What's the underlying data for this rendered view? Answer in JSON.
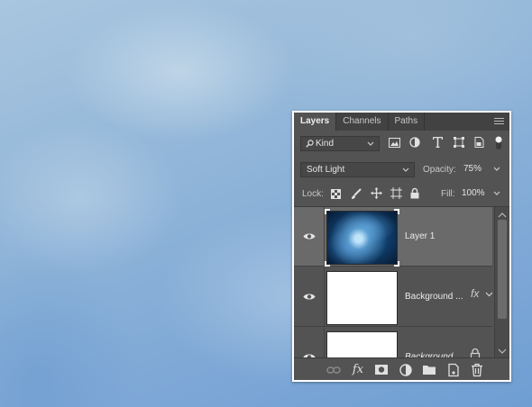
{
  "panel": {
    "tabs": [
      {
        "label": "Layers",
        "active": true
      },
      {
        "label": "Channels",
        "active": false
      },
      {
        "label": "Paths",
        "active": false
      }
    ],
    "filter": {
      "kind_label": "Kind"
    },
    "blend_mode": "Soft Light",
    "opacity": {
      "label": "Opacity:",
      "value": "75%"
    },
    "lock": {
      "label": "Lock:"
    },
    "fill": {
      "label": "Fill:",
      "value": "100%"
    },
    "layers": [
      {
        "name": "Layer 1",
        "visible": true,
        "selected": true,
        "thumbnail": "blue-space-texture"
      },
      {
        "name": "Background ...",
        "visible": true,
        "selected": false,
        "thumbnail": "white",
        "has_fx": true
      },
      {
        "name": "Background",
        "visible": true,
        "selected": false,
        "thumbnail": "white",
        "locked": true
      }
    ],
    "footer_icons": [
      "link-icon",
      "fx-icon",
      "mask-icon",
      "adjustment-icon",
      "folder-icon",
      "new-layer-icon",
      "trash-icon"
    ]
  },
  "colors": {
    "panel_bg": "#535353",
    "tab_bar": "#424242",
    "selected_row": "#6a6a6a",
    "canvas_blue": "#80a9d6"
  }
}
